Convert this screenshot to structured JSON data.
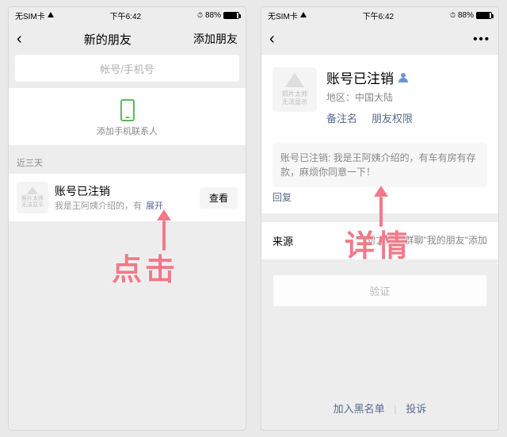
{
  "status": {
    "carrier": "无SIM卡",
    "time": "下午6:42",
    "battery": "88%"
  },
  "left": {
    "nav_title": "新的朋友",
    "nav_action": "添加朋友",
    "search_placeholder": "帐号/手机号",
    "add_contacts_label": "添加手机联系人",
    "section_label": "近三天",
    "avatar_text1": "照片太帅",
    "avatar_text2": "无法显示",
    "request_name": "账号已注销",
    "request_msg": "我是王阿姨介绍的，有",
    "expand_label": "展开",
    "view_btn": "查看"
  },
  "right": {
    "avatar_text1": "照片太帅",
    "avatar_text2": "无法显示",
    "profile_name": "账号已注销",
    "region_label": "地区：中国大陆",
    "link_remark": "备注名",
    "link_perm": "朋友权限",
    "message": "账号已注销: 我是王阿姨介绍的，有车有房有存款，麻烦你同意一下！",
    "reply_label": "回复",
    "source_label": "来源",
    "source_value": "对方通过群聊\"我的朋友\"添加",
    "verify_btn": "验证",
    "blacklist": "加入黑名单",
    "report": "投诉"
  },
  "annotations": {
    "click": "点击",
    "detail": "详情"
  }
}
